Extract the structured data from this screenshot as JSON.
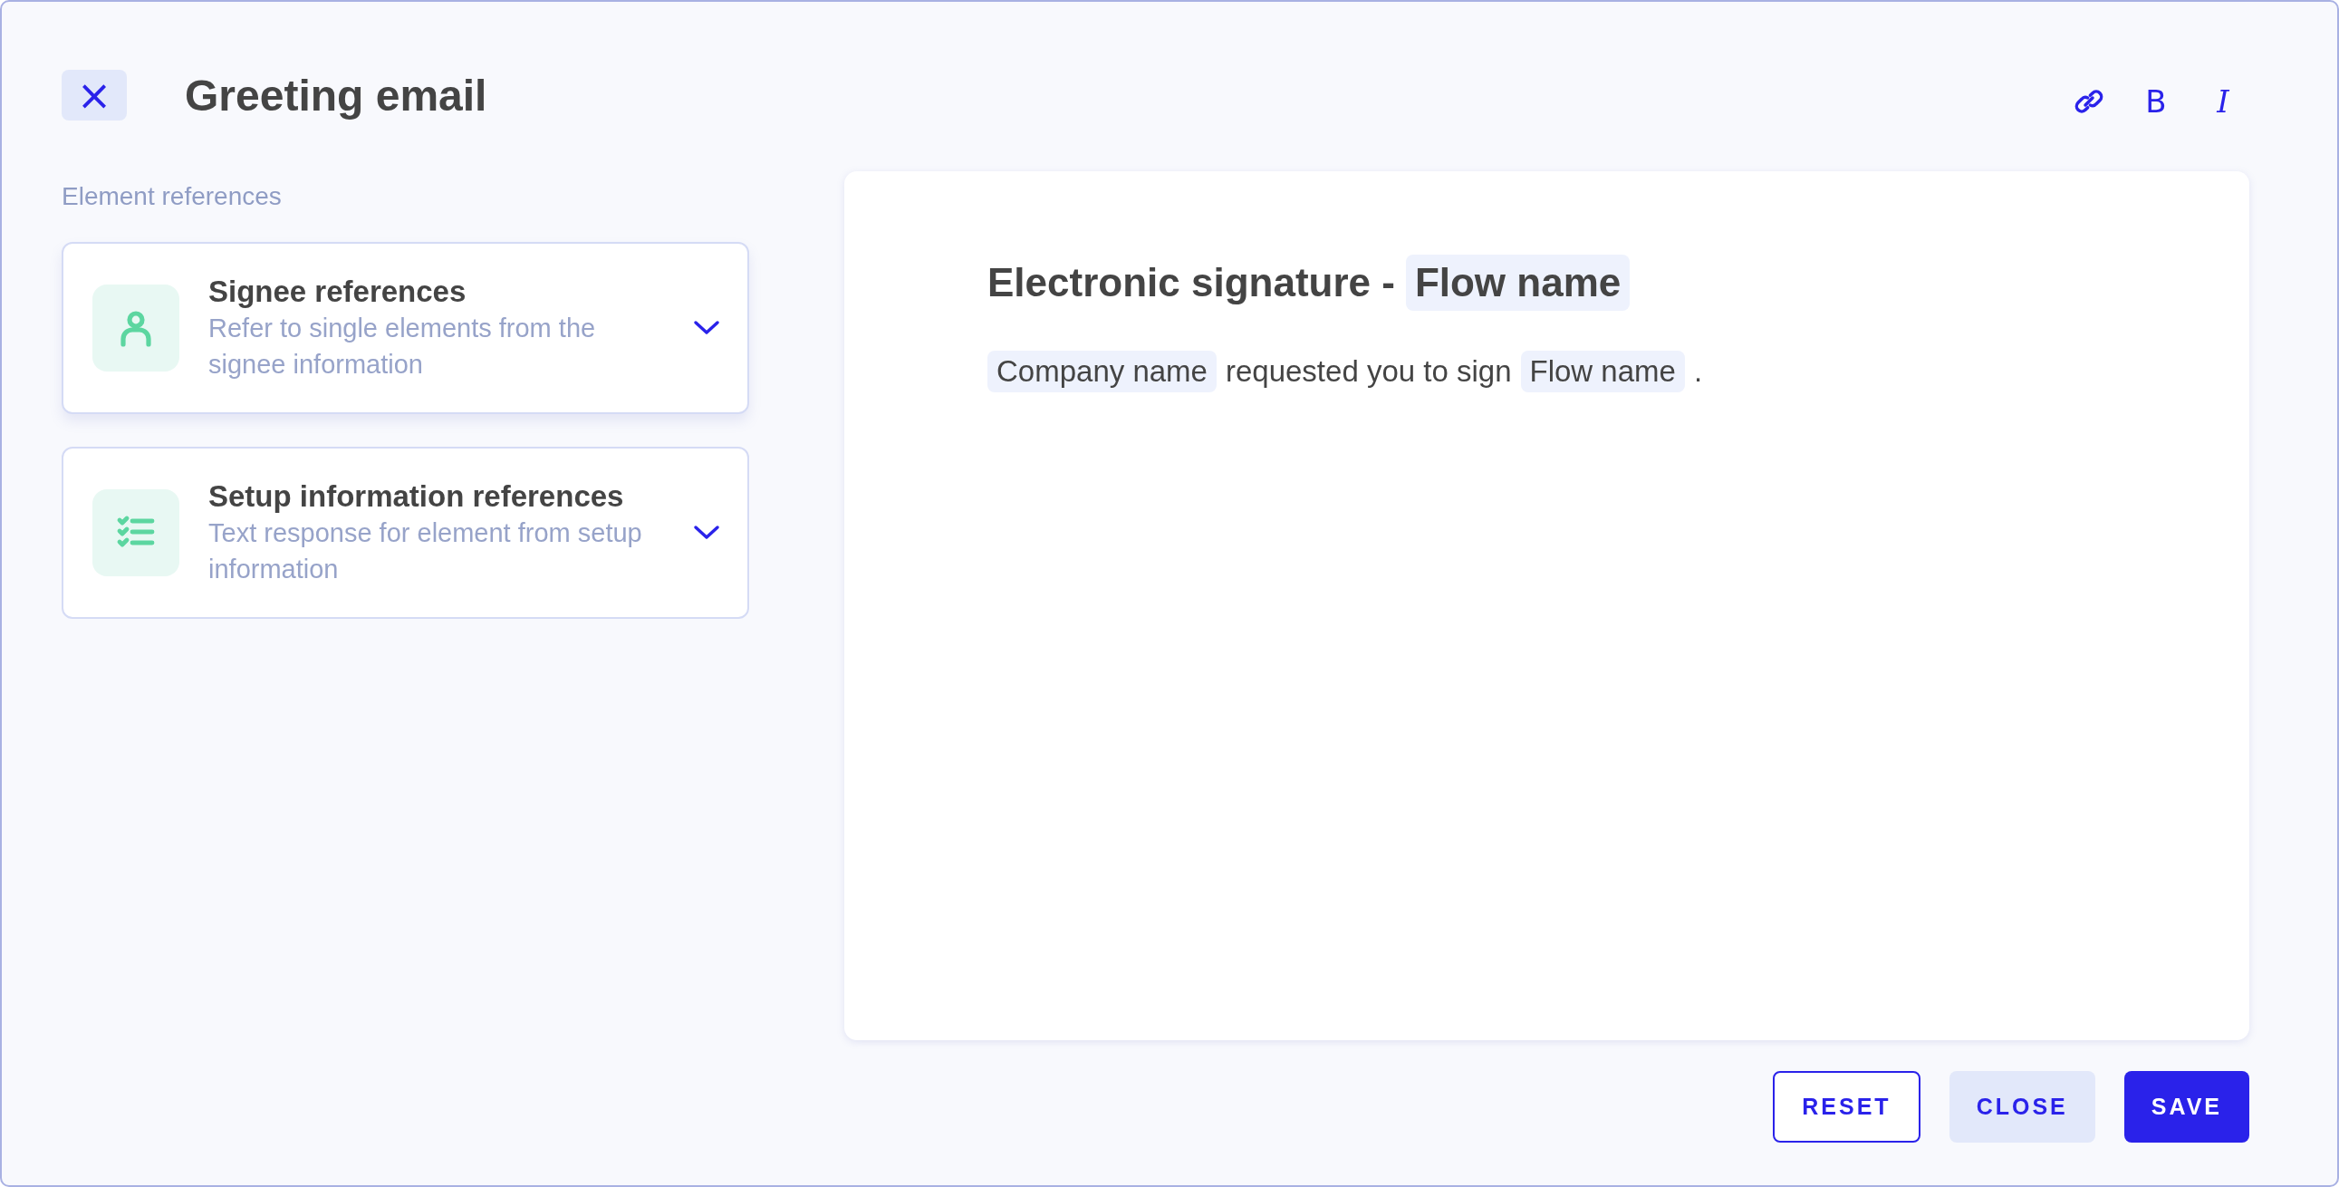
{
  "header": {
    "close_button": "×",
    "title": "Greeting email"
  },
  "toolbar": [
    {
      "kind": "link"
    },
    {
      "kind": "bold",
      "label": "B"
    },
    {
      "kind": "italic",
      "label": "I"
    }
  ],
  "sidebar": {
    "label": "Element references",
    "cards": [
      {
        "kind": "person",
        "title": "Signee references",
        "description": "Refer to single elements from the signee information",
        "expanded": false,
        "highlighted": true
      },
      {
        "kind": "checklist",
        "title": "Setup information references",
        "description": "Text response for element from setup information",
        "expanded": false,
        "highlighted": false
      }
    ]
  },
  "editor": {
    "heading": [
      {
        "kind": "text",
        "text": "Electronic signature -"
      },
      {
        "kind": "tag",
        "text": "Flow name"
      }
    ],
    "body": [
      {
        "kind": "tag",
        "text": "Company name"
      },
      {
        "kind": "text",
        "text": "requested you to sign"
      },
      {
        "kind": "tag",
        "text": "Flow name"
      },
      {
        "kind": "text",
        "text": "."
      }
    ]
  },
  "buttons": [
    {
      "kind": "outline",
      "label": "RESET"
    },
    {
      "kind": "soft",
      "label": "CLOSE"
    },
    {
      "kind": "primary",
      "label": "SAVE"
    }
  ]
}
